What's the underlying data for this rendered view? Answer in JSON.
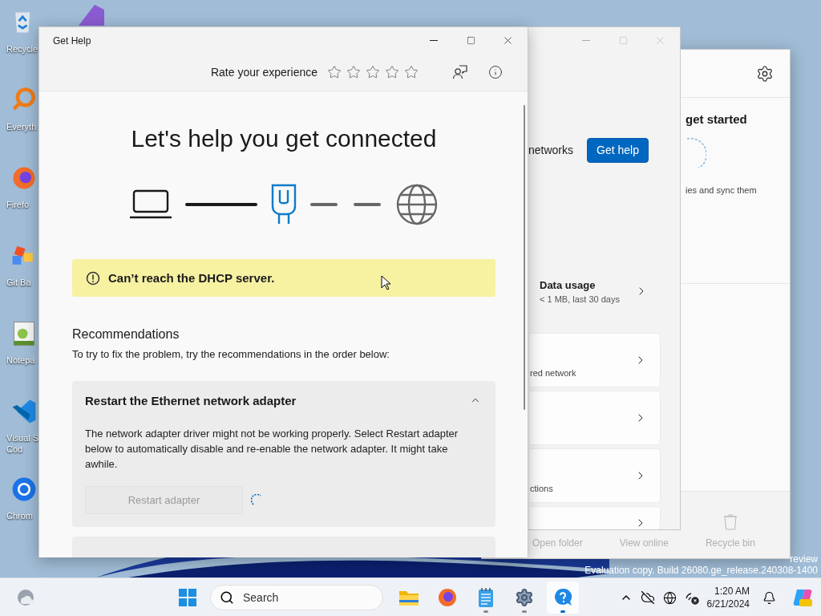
{
  "desktop": {
    "icons": [
      {
        "kind": "recycle",
        "lines": [
          "Recycle"
        ]
      },
      {
        "kind": "everything",
        "lines": [
          "Everyth"
        ]
      },
      {
        "kind": "firefox",
        "lines": [
          "Firefo"
        ]
      },
      {
        "kind": "gitbash",
        "lines": [
          "Git Ba"
        ]
      },
      {
        "kind": "notepad",
        "lines": [
          "Notepa"
        ]
      },
      {
        "kind": "vscode",
        "lines": [
          "Visual S",
          "Cod"
        ]
      },
      {
        "kind": "chrome",
        "lines": [
          "Chrom"
        ]
      }
    ]
  },
  "onedrive_window": {
    "heading": "get started",
    "caption": "ies and sync them",
    "footer": [
      {
        "label": "Open folder",
        "disabled": true
      },
      {
        "label": "View online",
        "disabled": true
      },
      {
        "label": "Recycle bin",
        "disabled": true
      }
    ]
  },
  "settings_window": {
    "network_label": "networks",
    "get_help_button": "Get help",
    "data_usage": {
      "title": "Data usage",
      "subtitle": "< 1 MB, last 30 days"
    },
    "cards": [
      {
        "kind": "text",
        "text": "red network"
      },
      {
        "kind": "blank"
      },
      {
        "kind": "text",
        "text": "ctions"
      },
      {
        "kind": "blank"
      }
    ]
  },
  "get_help_window": {
    "title": "Get Help",
    "rating": {
      "label": "Rate your experience",
      "stars": 0
    },
    "heading": "Let's help you get connected",
    "alert": {
      "message": "Can’t reach the DHCP server."
    },
    "recommendations": {
      "title": "Recommendations",
      "intro": "To try to fix the problem, try the recommendations in the order below:",
      "items": [
        {
          "title": "Restart the Ethernet network adapter",
          "expanded": true,
          "body": "The network adapter driver might not be working properly. Select Restart adapter below to automatically disable and re-enable the network adapter. It might take awhile.",
          "button": {
            "label": "Restart adapter",
            "disabled": true
          },
          "busy": true
        },
        {
          "expanded": false
        }
      ]
    }
  },
  "taskbar": {
    "search_placeholder": "Search",
    "apps": [
      {
        "kind": "explorer",
        "running": false,
        "selected": false
      },
      {
        "kind": "firefox",
        "running": false,
        "selected": false
      },
      {
        "kind": "notepad",
        "running": true,
        "selected": false
      },
      {
        "kind": "settings",
        "running": true,
        "selected": false
      },
      {
        "kind": "help",
        "running": true,
        "selected": true
      }
    ],
    "clock": {
      "time": "1:20 AM",
      "date": "6/21/2024"
    }
  },
  "watermark": {
    "lines": [
      "review",
      "Evaluation copy. Build 26080.ge_release.240308-1400"
    ]
  }
}
